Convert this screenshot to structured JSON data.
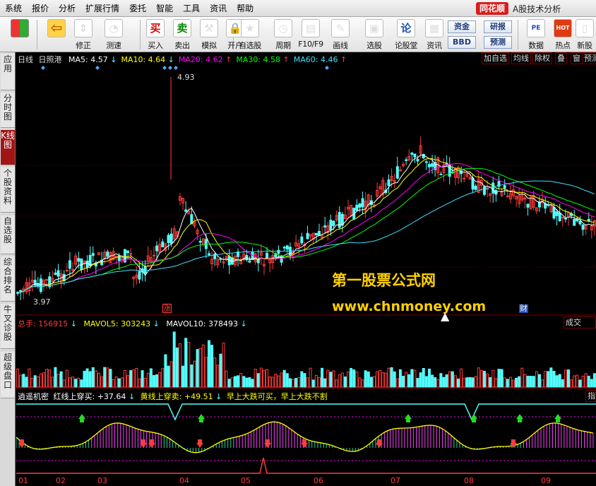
{
  "menu": [
    "系统",
    "报价",
    "分析",
    "扩展行情",
    "委托",
    "智能",
    "工具",
    "资讯",
    "帮助"
  ],
  "brand": {
    "logo": "同花顺",
    "title": "A股技术分析"
  },
  "toolbar": {
    "buttons": [
      {
        "label": "修正",
        "icon": "up-down-arrows-icon"
      },
      {
        "label": "测速",
        "icon": "speed-dial-icon"
      },
      {
        "label": "买入",
        "icon": "buy-icon",
        "glyph": "买"
      },
      {
        "label": "卖出",
        "icon": "sell-icon",
        "glyph": "卖"
      },
      {
        "label": "模拟",
        "icon": "hammer-icon"
      },
      {
        "label": "开户",
        "icon": "lock-icon"
      },
      {
        "label": "自选股",
        "icon": "star-icon"
      },
      {
        "label": "周期",
        "icon": "clock-icon"
      },
      {
        "label": "F10/F9",
        "icon": "f10-icon"
      },
      {
        "label": "画线",
        "icon": "pencil-icon"
      },
      {
        "label": "选股",
        "icon": "monitor-icon"
      },
      {
        "label": "论股堂",
        "icon": "forum-icon",
        "glyph": "论"
      },
      {
        "label": "资讯",
        "icon": "document-icon"
      },
      {
        "label": "数据",
        "icon": "pe-icon",
        "glyph": "PE"
      },
      {
        "label": "热点",
        "icon": "hot-icon",
        "glyph": "HOT"
      },
      {
        "label": "新股",
        "icon": "new-stock-icon"
      }
    ],
    "flat_buttons": [
      "资金",
      "研报",
      "BBD",
      "预测"
    ]
  },
  "left_tabs": [
    "应用",
    "分时图",
    "K线图",
    "个股资料",
    "自选股",
    "综合排名",
    "牛叉诊股",
    "超级盘口"
  ],
  "main_panel": {
    "period": "日线",
    "stock": "日照港",
    "ma": [
      {
        "name": "MA5",
        "value": "4.57",
        "arrow": "↓",
        "color": "#ffffff"
      },
      {
        "name": "MA10",
        "value": "4.64",
        "arrow": "↓",
        "color": "#ffff00"
      },
      {
        "name": "MA20",
        "value": "4.62",
        "arrow": "↑",
        "color": "#ff00ff"
      },
      {
        "name": "MA30",
        "value": "4.58",
        "arrow": "↑",
        "color": "#00ff00"
      },
      {
        "name": "MA60",
        "value": "4.46",
        "arrow": "↑",
        "color": "#40e0ff"
      }
    ],
    "buttons": [
      "加自选",
      "均线",
      "除权",
      "叠",
      "窗",
      "预测"
    ],
    "high_label": "4.93",
    "low_label": "3.97",
    "marker_zhang": "涨",
    "marker_cai": "财"
  },
  "watermark": {
    "line1": "第一股票公式网",
    "line2": "www.chnmoney.com"
  },
  "volume_panel": {
    "total_label": "总手",
    "total_value": "156915",
    "total_arrow": "↓",
    "mavol5_label": "MAVOL5",
    "mavol5_value": "303243",
    "mavol5_arrow": "↓",
    "mavol10_label": "MAVOL10",
    "mavol10_value": "378493",
    "mavol10_arrow": "↓",
    "right_btn": "成交"
  },
  "indicator_panel": {
    "name": "逍遥机密",
    "red_label": "红线上穿买",
    "red_value": "+37.64",
    "red_arrow": "↓",
    "yellow_label": "黄线上穿卖",
    "yellow_value": "+49.51",
    "yellow_arrow": "↓",
    "note": "早上大跌可买，早上大跌不割",
    "right_btn": "指"
  },
  "x_axis": [
    "01",
    "02",
    "03",
    "04",
    "05",
    "06",
    "07",
    "08",
    "09"
  ],
  "colors": {
    "up": "#ff3b3b",
    "down": "#54ffff",
    "grid": "#7a0000",
    "ma5": "#ffffff",
    "ma10": "#ffff00",
    "ma20": "#ff00ff",
    "ma30": "#00ff00",
    "ma60": "#40e0ff"
  }
}
